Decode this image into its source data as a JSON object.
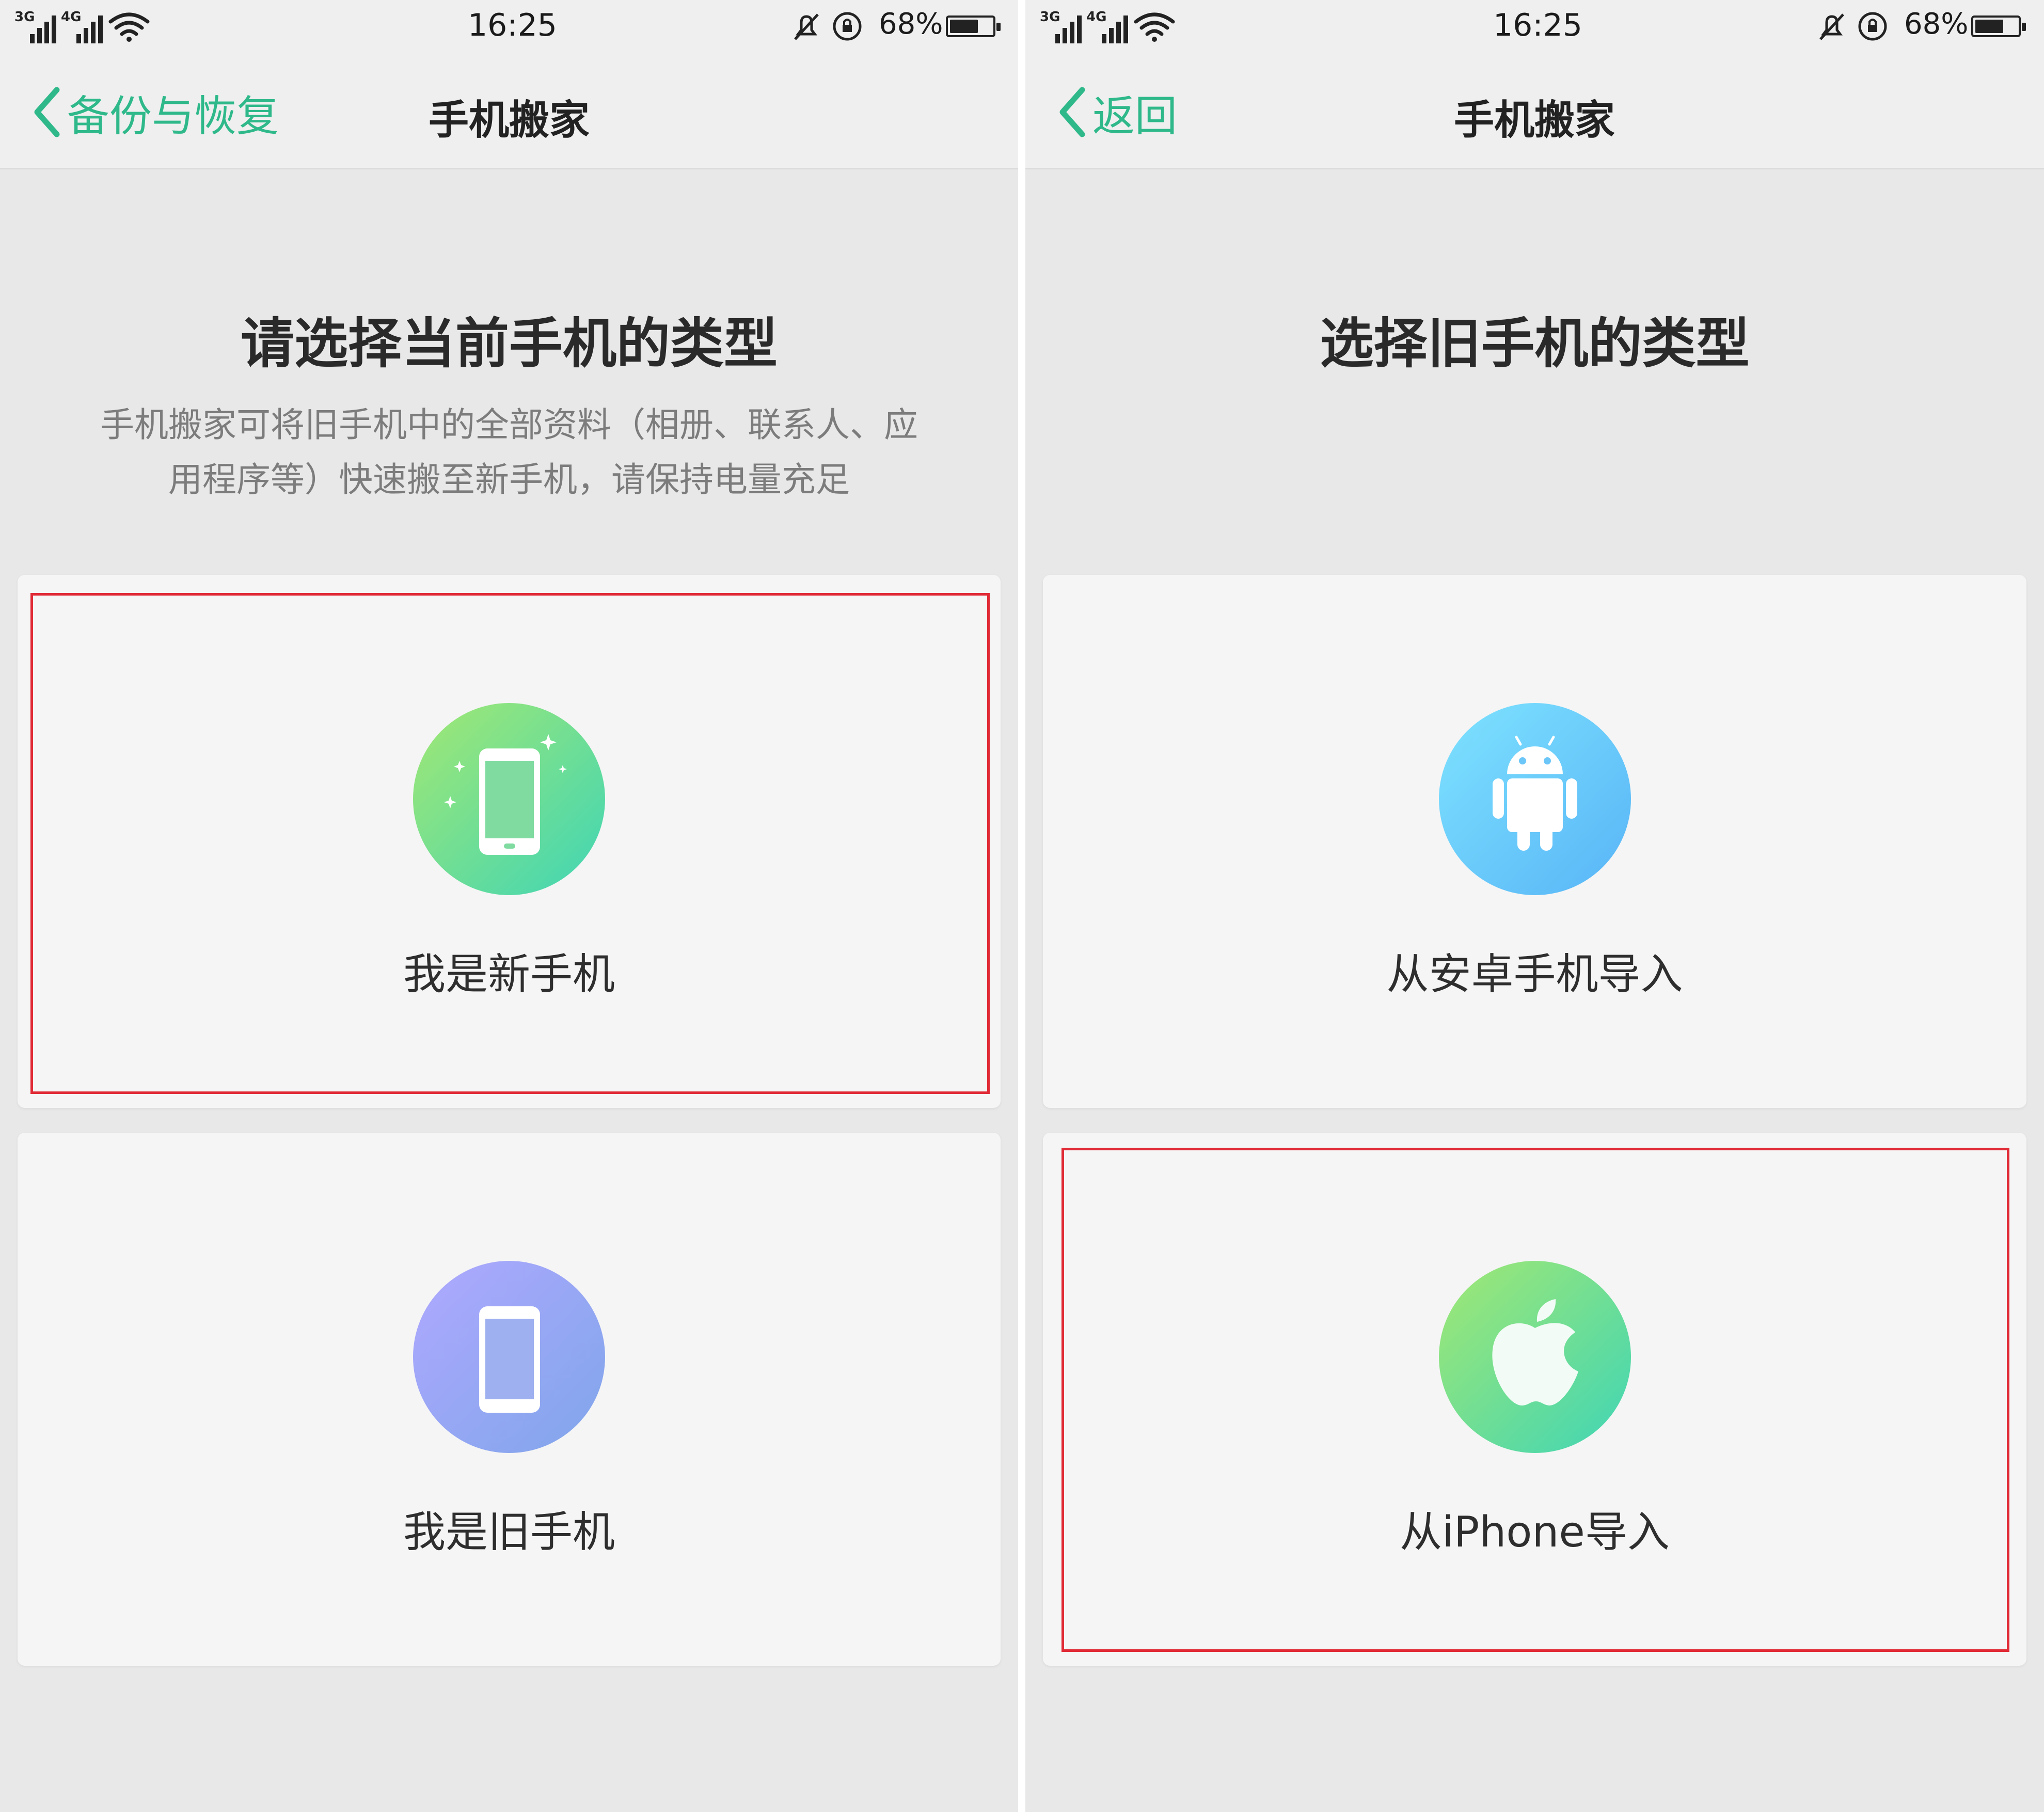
{
  "left": {
    "status": {
      "net1": "3G",
      "net2": "4G",
      "time": "16:25",
      "battery_pct": "68%",
      "battery_level": 0.68
    },
    "nav": {
      "back_label": "备份与恢复",
      "title": "手机搬家"
    },
    "heading": "请选择当前手机的类型",
    "description_lines": [
      "手机搬家可将旧手机中的全部资料（相册、联系人、应",
      "用程序等）快速搬至新手机，请保持电量充足"
    ],
    "options": [
      {
        "label": "我是新手机",
        "icon": "new-phone-icon",
        "highlighted": true
      },
      {
        "label": "我是旧手机",
        "icon": "old-phone-icon",
        "highlighted": false
      }
    ]
  },
  "right": {
    "status": {
      "net1": "3G",
      "net2": "4G",
      "time": "16:25",
      "battery_pct": "68%",
      "battery_level": 0.68
    },
    "nav": {
      "back_label": "返回",
      "title": "手机搬家"
    },
    "heading": "选择旧手机的类型",
    "options": [
      {
        "label": "从安卓手机导入",
        "icon": "android-icon",
        "highlighted": false
      },
      {
        "label": "从iPhone导入",
        "icon": "apple-icon",
        "highlighted": true
      }
    ]
  },
  "colors": {
    "accent": "#2fb98b",
    "highlight_border": "#e02a35",
    "new_phone_gradient": [
      "#a3e872",
      "#3fd5b6"
    ],
    "old_phone_gradient": [
      "#b0a8ff",
      "#7fa6ea"
    ],
    "android_gradient": [
      "#7ee3ff",
      "#58b4f6"
    ],
    "apple_gradient": [
      "#a3e872",
      "#3fd5b6"
    ]
  }
}
